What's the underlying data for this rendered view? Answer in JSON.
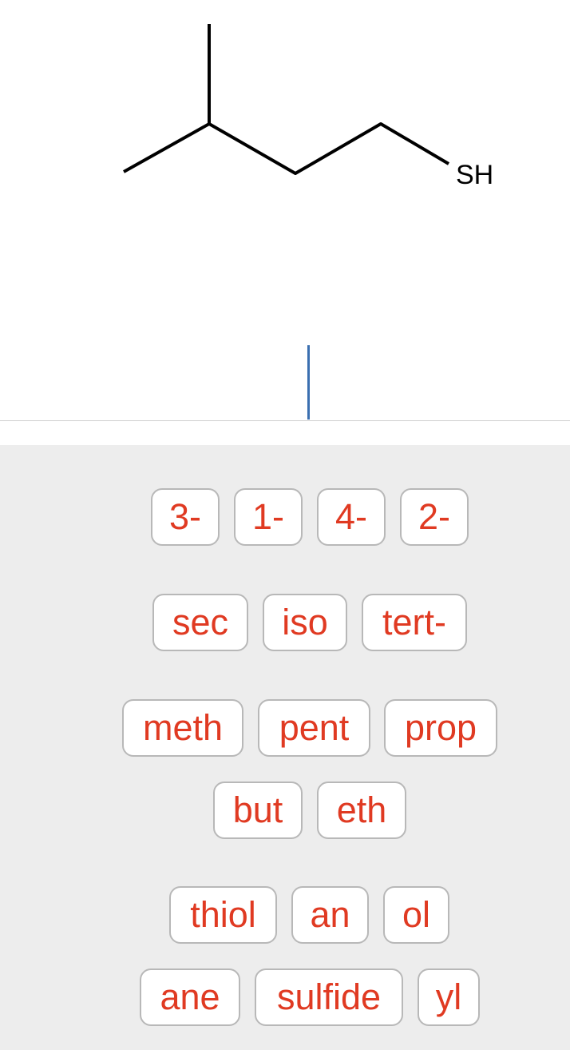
{
  "structure": {
    "atom_label": "SH"
  },
  "answer": {
    "value": ""
  },
  "tile_rows": [
    [
      "3-",
      "1-",
      "4-",
      "2-"
    ],
    [
      "sec",
      "iso",
      "tert-"
    ],
    [
      "meth",
      "pent",
      "prop"
    ],
    [
      "but",
      "eth"
    ],
    [
      "thiol",
      "an",
      "ol"
    ],
    [
      "ane",
      "sulfide",
      "yl"
    ]
  ],
  "colors": {
    "tile_text": "#e03a22",
    "caret": "#3a6fb0",
    "bank_background": "#ededed"
  }
}
